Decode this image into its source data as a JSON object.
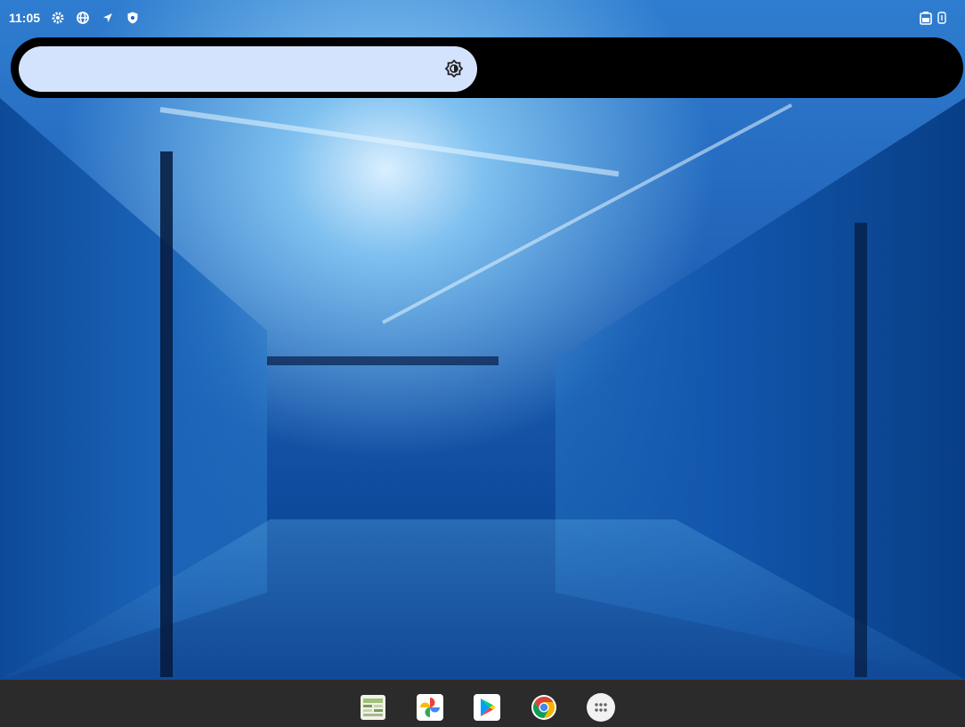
{
  "status_bar": {
    "time": "11:05",
    "icons": [
      "settings-icon",
      "vpn-globe-icon",
      "location-arrow-icon",
      "shield-icon"
    ],
    "right_icons": [
      "battery-icon",
      "sim-icon"
    ]
  },
  "search_bar": {
    "brightness_icon": "brightness-icon"
  },
  "dock": {
    "apps": [
      {
        "name": "spreadsheet-app-icon"
      },
      {
        "name": "google-photos-icon"
      },
      {
        "name": "play-store-icon"
      },
      {
        "name": "chrome-icon"
      },
      {
        "name": "app-drawer-icon"
      }
    ]
  },
  "colors": {
    "search_pill_fill": "#d3e3fd",
    "dock_bg": "#2b2b2b",
    "wallpaper_primary": "#1f5fb4"
  }
}
